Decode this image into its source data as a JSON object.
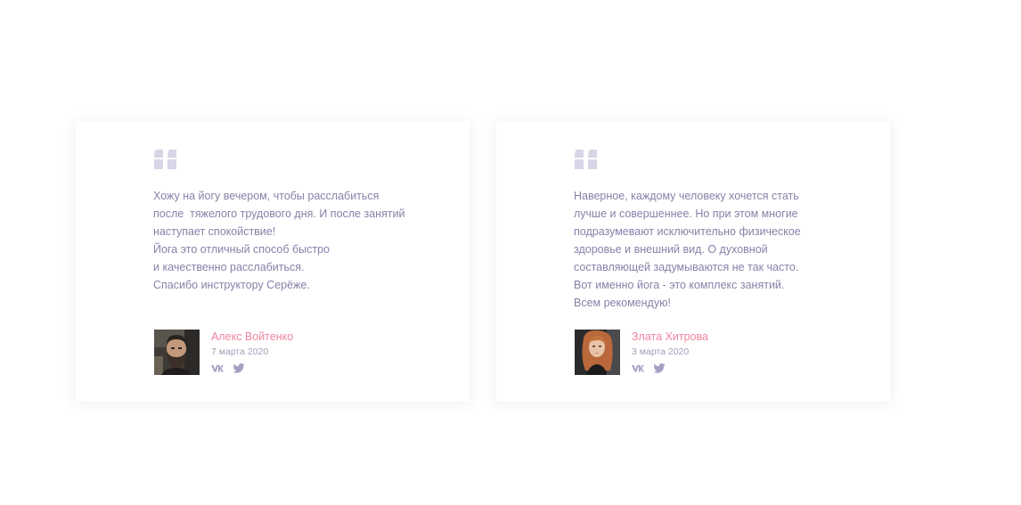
{
  "testimonials": [
    {
      "quote_lines": [
        "Хожу на йогу вечером, чтобы расслабиться",
        "после  тяжелого трудового дня. И после занятий",
        "наступает спокойствие!",
        "Йога это отличный способ быстро",
        "и качественно расслабиться.",
        "Спасибо инструктору Серёже."
      ],
      "author_name": "Алекс Войтенко",
      "date": "7 марта 2020",
      "avatar": "bearded-man-photo",
      "socials": [
        "vk-icon",
        "twitter-icon"
      ]
    },
    {
      "quote_lines": [
        "Наверное, каждому человеку хочется стать",
        "лучше и совершеннее. Но при этом многие",
        "подразумевают исключительно физическое",
        "здоровье и внешний вид. О духовной",
        "составляющей задумываются не так часто.",
        "Вот именно йога - это комплекс занятий.",
        "Всем рекомендую!"
      ],
      "author_name": "Злата Хитрова",
      "date": "3 марта 2020",
      "avatar": "red-haired-woman-photo",
      "socials": [
        "vk-icon",
        "twitter-icon"
      ]
    }
  ],
  "colors": {
    "text": "#8a7fa8",
    "name": "#f0859e",
    "date": "#a39db5",
    "quote_mark": "#d9d4e6",
    "icon": "#a79fc2"
  }
}
